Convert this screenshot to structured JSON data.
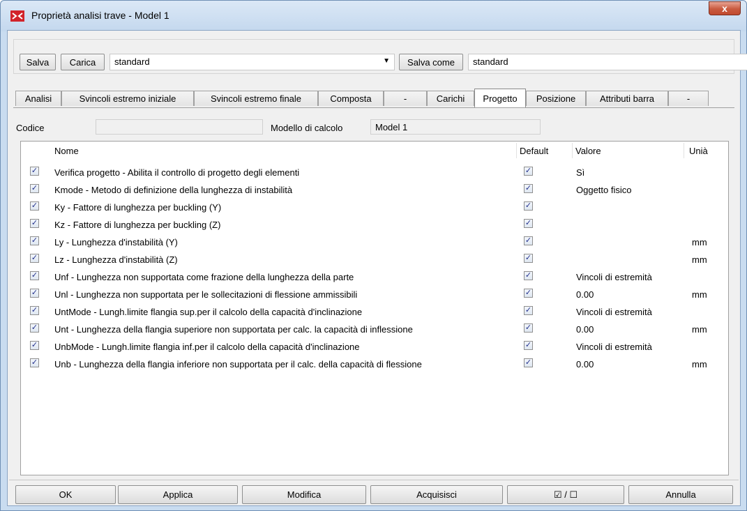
{
  "window": {
    "title": "Proprietà analisi trave - Model 1",
    "close_label": "x"
  },
  "toolbar": {
    "save_label": "Salva",
    "load_label": "Carica",
    "preset_value": "standard",
    "save_as_label": "Salva come",
    "save_as_value": "standard"
  },
  "tabs": [
    {
      "label": "Analisi",
      "active": false
    },
    {
      "label": "Svincoli estremo iniziale",
      "active": false
    },
    {
      "label": "Svincoli estremo finale",
      "active": false
    },
    {
      "label": "Composta",
      "active": false
    },
    {
      "label": "-",
      "active": false
    },
    {
      "label": "Carichi",
      "active": false
    },
    {
      "label": "Progetto",
      "active": true
    },
    {
      "label": "Posizione",
      "active": false
    },
    {
      "label": "Attributi barra",
      "active": false
    },
    {
      "label": "-",
      "active": false
    }
  ],
  "fields": {
    "code_label": "Codice",
    "code_value": "",
    "model_label": "Modello di calcolo",
    "model_value": "Model 1"
  },
  "list": {
    "headers": {
      "name": "Nome",
      "default": "Default",
      "value": "Valore",
      "unit": "Unià"
    },
    "rows": [
      {
        "checked": true,
        "name": "Verifica progetto - Abilita il controllo di progetto degli elementi",
        "default": true,
        "value": "Sì",
        "unit": ""
      },
      {
        "checked": true,
        "name": "Kmode - Metodo di definizione della lunghezza di instabilità",
        "default": true,
        "value": "Oggetto fisico",
        "unit": ""
      },
      {
        "checked": true,
        "name": "Ky - Fattore di lunghezza per buckling (Y)",
        "default": true,
        "value": "",
        "unit": ""
      },
      {
        "checked": true,
        "name": "Kz - Fattore di lunghezza per buckling (Z)",
        "default": true,
        "value": "",
        "unit": ""
      },
      {
        "checked": true,
        "name": "Ly - Lunghezza d'instabilità (Y)",
        "default": true,
        "value": "",
        "unit": "mm"
      },
      {
        "checked": true,
        "name": "Lz - Lunghezza d'instabilità (Z)",
        "default": true,
        "value": "",
        "unit": "mm"
      },
      {
        "checked": true,
        "name": "Unf - Lunghezza non supportata come frazione della lunghezza della parte",
        "default": true,
        "value": "Vincoli di estremità",
        "unit": ""
      },
      {
        "checked": true,
        "name": "Unl - Lunghezza non supportata per le sollecitazioni di flessione ammissibili",
        "default": true,
        "value": "0.00",
        "unit": "mm"
      },
      {
        "checked": true,
        "name": "UntMode - Lungh.limite flangia sup.per il calcolo della capacità d'inclinazione",
        "default": true,
        "value": "Vincoli di estremità",
        "unit": ""
      },
      {
        "checked": true,
        "name": "Unt - Lunghezza della flangia superiore non supportata per calc. la capacità di inflessione",
        "default": true,
        "value": "0.00",
        "unit": "mm"
      },
      {
        "checked": true,
        "name": "UnbMode - Lungh.limite flangia inf.per il calcolo della capacità d'inclinazione",
        "default": true,
        "value": "Vincoli di estremità",
        "unit": ""
      },
      {
        "checked": true,
        "name": "Unb - Lunghezza della flangia inferiore non supportata per il calc. della capacità di flessione",
        "default": true,
        "value": "0.00",
        "unit": "mm"
      }
    ]
  },
  "buttons": {
    "ok": "OK",
    "apply": "Applica",
    "modify": "Modifica",
    "acquire": "Acquisisci",
    "toggle": "☑ / ☐",
    "cancel": "Annulla"
  },
  "colors": {
    "title_bar": "#c9dcf0",
    "close_button": "#c95a3f",
    "check_mark": "#22308c"
  }
}
